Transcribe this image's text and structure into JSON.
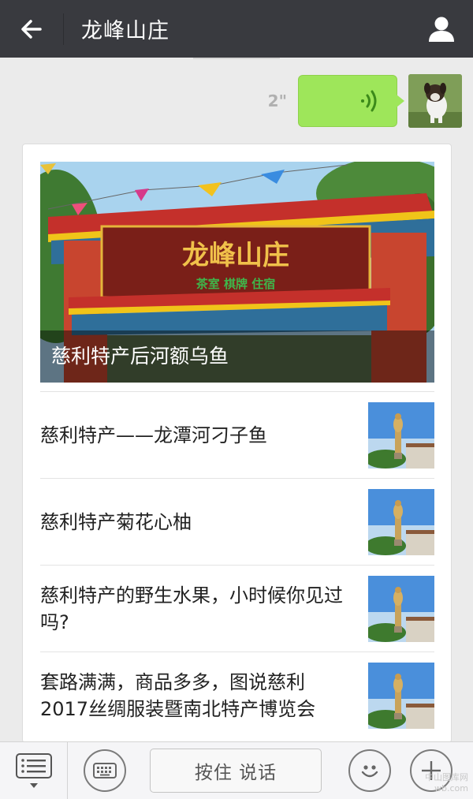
{
  "header": {
    "title": "龙峰山庄",
    "back_icon": "arrow-left-icon",
    "user_icon": "person-icon"
  },
  "message": {
    "duration": "2\"",
    "type": "voice",
    "bubble_color": "#9ee65a"
  },
  "article": {
    "cover": {
      "sign_title": "龙峰山庄",
      "sign_subtitle": "茶室 棋牌 住宿",
      "caption": "慈利特产后河额乌鱼"
    },
    "items": [
      {
        "title": "慈利特产——龙潭河刁子鱼"
      },
      {
        "title": "慈利特产菊花心柚"
      },
      {
        "title": "慈利特产的野生水果，小时候你见过吗?"
      },
      {
        "title": "套路满满，商品多多，图说慈利2017丝绸服装暨南北特产博览会"
      }
    ]
  },
  "input_bar": {
    "talk_label": "按住 说话",
    "menu_icon": "list-menu-icon",
    "keyboard_icon": "keyboard-icon",
    "emoji_icon": "smiley-icon",
    "plus_icon": "plus-icon"
  },
  "watermark": {
    "line1": "中山图库网",
    "line2": "wb.com"
  },
  "colors": {
    "topbar": "#393a3f",
    "background": "#ebebeb",
    "voice_bubble": "#9ee65a"
  }
}
